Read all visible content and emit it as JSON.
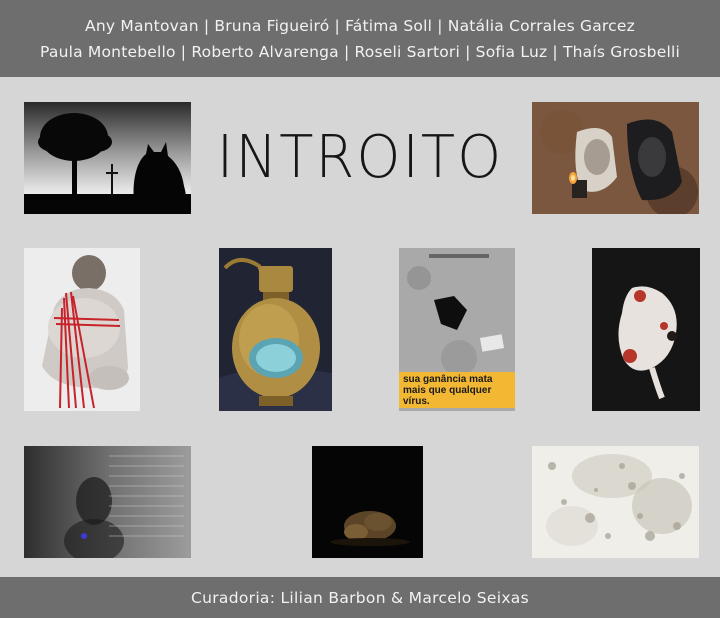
{
  "header": {
    "artists_line_1": "Any Mantovan | Bruna Figueiró | Fátima Soll | Natália Corrales Garcez",
    "artists_line_2": "Paula Montebello | Roberto Alvarenga | Roseli Sartori | Sofia Luz | Thaís Grosbelli"
  },
  "title": "INTROITO",
  "artworks": {
    "poster_text": "sua ganância mata mais que qualquer vírus."
  },
  "footer": {
    "curators": "Curadoria: Lilian Barbon & Marcelo Seixas"
  },
  "colors": {
    "band": "#6e6e6e",
    "background": "#d6d6d6",
    "poster_label": "#f2b733"
  }
}
